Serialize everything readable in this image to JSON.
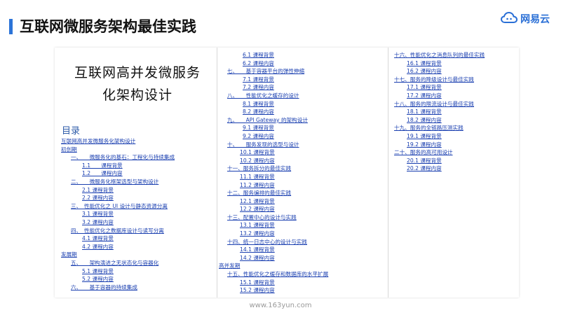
{
  "header": {
    "title": "互联网微服务架构最佳实践"
  },
  "logo": {
    "text": "网易云",
    "icon": "cloud-icon",
    "accent": "#2a6fd6"
  },
  "document": {
    "cover_title_line1": "互联网高并发微服务",
    "cover_title_line2": "化架构设计",
    "toc_heading": "目录",
    "col1": [
      {
        "text": "互联网高并发微服务化架构设计",
        "indent": 0
      },
      {
        "text": "初创期",
        "indent": 0
      },
      {
        "text": "一、　　微服务化的基石：工程化与持续集成",
        "indent": 14
      },
      {
        "text": "1.1　　课程背景",
        "indent": 30
      },
      {
        "text": "1.2　　课程内容",
        "indent": 30
      },
      {
        "text": "二、　　微服务化框架选型与架构设计",
        "indent": 14
      },
      {
        "text": "2.1 课程背景",
        "indent": 30
      },
      {
        "text": "2.2 课程内容",
        "indent": 30
      },
      {
        "text": "三、　性能优化之 UI 设计与静态资源分离",
        "indent": 14
      },
      {
        "text": "3.1 课程背景",
        "indent": 30
      },
      {
        "text": "3.2 课程内容",
        "indent": 30
      },
      {
        "text": "四、　性能优化之数据库设计与读写分离",
        "indent": 14
      },
      {
        "text": "4.1 课程背景",
        "indent": 30
      },
      {
        "text": "4.2 课程内容",
        "indent": 30
      },
      {
        "text": "发展期",
        "indent": 0
      },
      {
        "text": "五、　　架构演进之无状态化与容器化",
        "indent": 14
      },
      {
        "text": "5.1 课程背景",
        "indent": 30
      },
      {
        "text": "5.2 课程内容",
        "indent": 30
      },
      {
        "text": "六、　　基于容器的持续集成",
        "indent": 14
      }
    ],
    "col2": [
      {
        "text": "6.1 课程背景",
        "indent": 22
      },
      {
        "text": "6.2 课程内容",
        "indent": 22
      },
      {
        "text": "七、　　基于容器平台的弹性伸缩",
        "indent": 0
      },
      {
        "text": "7.1 课程背景",
        "indent": 22
      },
      {
        "text": "7.2 课程内容",
        "indent": 22
      },
      {
        "text": "八、　　性能优化之缓存的设计",
        "indent": 0
      },
      {
        "text": "8.1 课程背景",
        "indent": 22
      },
      {
        "text": "8.2 课程内容",
        "indent": 22
      },
      {
        "text": "九、　　API Gateway 的架构设计",
        "indent": 0
      },
      {
        "text": "9.1 课程背景",
        "indent": 22
      },
      {
        "text": "9.2 课程内容",
        "indent": 22
      },
      {
        "text": "十、　　服务发现的选型与设计",
        "indent": 0
      },
      {
        "text": "10.1 课程背景",
        "indent": 18
      },
      {
        "text": "10.2 课程内容",
        "indent": 18
      },
      {
        "text": "十一、服务拆分的最佳实践",
        "indent": 0
      },
      {
        "text": "11.1 课程背景",
        "indent": 18
      },
      {
        "text": "11.2 课程内容",
        "indent": 18
      },
      {
        "text": "十二、服务编排的最佳实践",
        "indent": 0
      },
      {
        "text": "12.1 课程背景",
        "indent": 18
      },
      {
        "text": "12.2 课程内容",
        "indent": 18
      },
      {
        "text": "十三、配置中心的设计与实践",
        "indent": 0
      },
      {
        "text": "13.1 课程背景",
        "indent": 18
      },
      {
        "text": "13.2 课程内容",
        "indent": 18
      },
      {
        "text": "十四、统一日志中心的设计与实践",
        "indent": 0
      },
      {
        "text": "14.1 课程背景",
        "indent": 18
      },
      {
        "text": "14.2 课程内容",
        "indent": 18
      },
      {
        "text": "高并发期",
        "indent": -12
      },
      {
        "text": "十五、性能优化之缓存和数据库的水平扩展",
        "indent": 0
      },
      {
        "text": "15.1 课程背景",
        "indent": 18
      },
      {
        "text": "15.2 课程内容",
        "indent": 18
      }
    ],
    "col3": [
      {
        "text": "十六、性能优化之消息队列的最佳实践",
        "indent": 0
      },
      {
        "text": "16.1 课程背景",
        "indent": 18
      },
      {
        "text": "16.2 课程内容",
        "indent": 18
      },
      {
        "text": "十七、服务的降级设计与最佳实践",
        "indent": 0
      },
      {
        "text": "17.1 课程背景",
        "indent": 18
      },
      {
        "text": "17.2 课程内容",
        "indent": 18
      },
      {
        "text": "十八、服务的限流设计与最佳实践",
        "indent": 0
      },
      {
        "text": "18.1 课程背景",
        "indent": 18
      },
      {
        "text": "18.2 课程内容",
        "indent": 18
      },
      {
        "text": "十九、服务的全链路压测实践",
        "indent": 0
      },
      {
        "text": "19.1 课程背景",
        "indent": 18
      },
      {
        "text": "19.2 课程内容",
        "indent": 18
      },
      {
        "text": "二十、服务的高可用设计",
        "indent": 0
      },
      {
        "text": "20.1 课程背景",
        "indent": 18
      },
      {
        "text": "20.2 课程内容",
        "indent": 18
      }
    ]
  },
  "footer": {
    "url": "www.163yun.com"
  }
}
